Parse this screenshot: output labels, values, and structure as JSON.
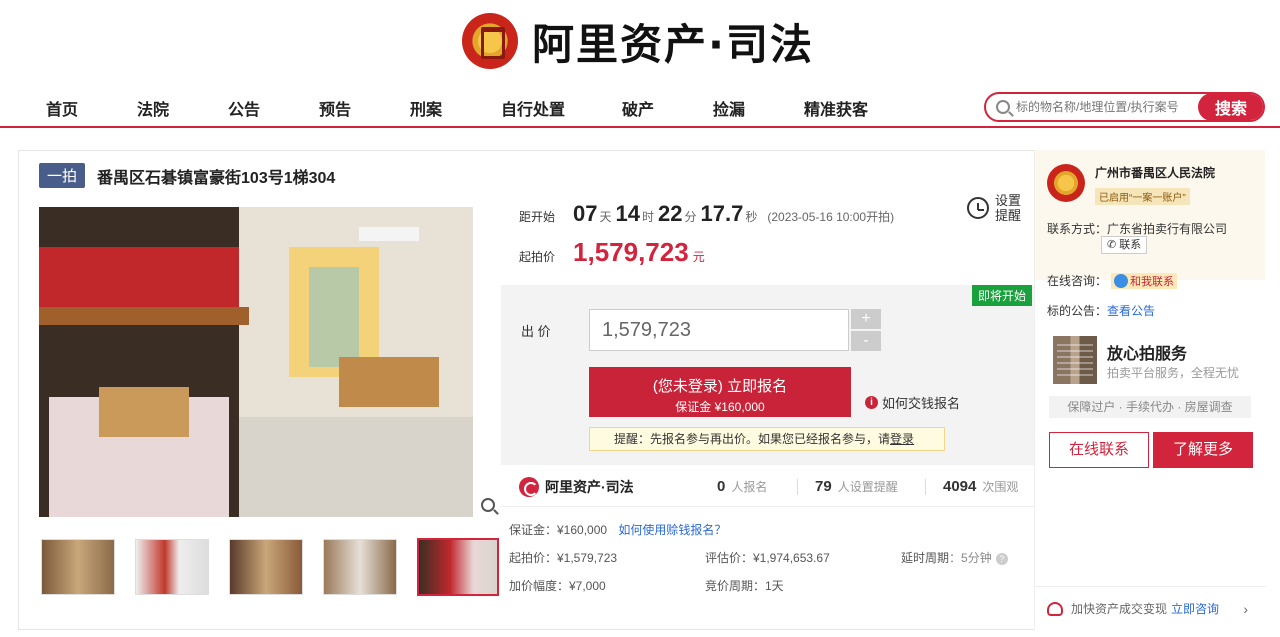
{
  "brand": {
    "title": "阿里资产·司法"
  },
  "nav": {
    "items": [
      "首页",
      "法院",
      "公告",
      "预告",
      "刑案",
      "自行处置",
      "破产",
      "捡漏",
      "精准获客"
    ],
    "search_placeholder": "标的物名称/地理位置/执行案号",
    "search_button": "搜索"
  },
  "listing": {
    "tag": "一拍",
    "title": "番禺区石碁镇富豪街103号1梯304"
  },
  "auction": {
    "countdown_label": "距开始",
    "days": "07",
    "days_unit": "天",
    "hours": "14",
    "hours_unit": "时",
    "minutes": "22",
    "minutes_unit": "分",
    "seconds": "17.7",
    "seconds_unit": "秒",
    "start_time": "(2023-05-16 10:00开拍)",
    "remind_label": "设置提醒",
    "start_price_label": "起拍价",
    "start_price": "1,579,723",
    "currency": "元",
    "status_badge": "即将开始",
    "bid_label": "出 价",
    "bid_value": "1,579,723",
    "plus": "+",
    "minus": "-",
    "signup_line1": "(您未登录) 立即报名",
    "signup_line2": "保证金 ¥160,000",
    "how_to_pay": "如何交钱报名",
    "tip_text": "提醒：先报名参与再出价。如果您已经报名参与，请",
    "tip_login": "登录"
  },
  "stats": {
    "brand": "阿里资产·司法",
    "signups": "0",
    "signups_label": "人报名",
    "reminders": "79",
    "reminders_label": "人设置提醒",
    "views": "4094",
    "views_label": "次围观"
  },
  "details": {
    "deposit": "保证金：¥160,000",
    "deposit_link": "如何使用赊钱报名？",
    "start_price": "起拍价：¥1,579,723",
    "appraisal": "评估价：¥1,974,653.67",
    "delay_label": "延时周期",
    "delay_value": "：5分钟",
    "increment": "加价幅度：¥7,000",
    "cycle": "竞价周期：1天"
  },
  "sidebar": {
    "court": "广州市番禺区人民法院",
    "court_tag": "已启用“一案一账户”",
    "contact": "联系方式：广东省拍卖行有限公司",
    "contact_btn": "联系",
    "consult_label": "在线咨询：",
    "consult_btn": "和我联系",
    "notice_label": "标的公告：",
    "notice_link": "查看公告",
    "service_title": "放心拍服务",
    "service_sub": "拍卖平台服务，全程无忧",
    "service_tags": "保障过户 · 手续代办 · 房屋调查",
    "btn_online": "在线联系",
    "btn_more": "了解更多",
    "footer_text": "加快资产成交变现",
    "footer_link": "立即咨询"
  }
}
